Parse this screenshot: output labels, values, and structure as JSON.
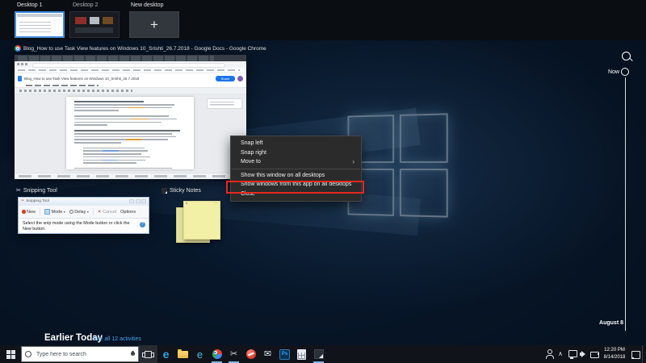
{
  "desktops_bar": {
    "desktops": [
      {
        "label": "Desktop 1",
        "selected": true
      },
      {
        "label": "Desktop 2",
        "selected": false
      }
    ],
    "new_desktop_label": "New desktop"
  },
  "thumbnails": {
    "chrome": {
      "title": "Blog_How to use Task View features on Windows 10_Srishti_26.7.2018 - Google Docs - Google Chrome",
      "doc_title": "Blog_How to use Task View features on Windows 10_Srishti_26.7.2018",
      "share_label": "Share"
    },
    "snipping_tool": {
      "label": "Snipping Tool",
      "window_title": "Snipping Tool",
      "toolbar": {
        "new_label": "New",
        "mode_label": "Mode",
        "delay_label": "Delay",
        "cancel_label": "Cancel",
        "options_label": "Options"
      },
      "message": "Select the snip mode using the Mode button or click the New button."
    },
    "sticky_notes": {
      "label": "Sticky Notes"
    }
  },
  "context_menu": {
    "items": [
      {
        "label": "Snap left"
      },
      {
        "label": "Snap right"
      },
      {
        "label": "Move to",
        "has_submenu": true
      },
      {
        "label": "Show this window on all desktops"
      },
      {
        "label": "Show windows from this app on all desktops",
        "highlighted": true
      },
      {
        "label": "Close"
      }
    ],
    "highlight_color": "#e8281e"
  },
  "timeline": {
    "now_label": "Now",
    "date_marker": "August 8"
  },
  "activities": {
    "heading": "Earlier Today",
    "see_all_label": "See all 12 activities"
  },
  "taskbar": {
    "search_placeholder": "Type here to search",
    "app_icons": [
      "task-view",
      "edge",
      "file-explorer",
      "internet-explorer",
      "chrome",
      "snipping-tool",
      "red-browser",
      "mail",
      "photoshop",
      "calculator",
      "sticky-notes"
    ],
    "tray_icons": [
      "people",
      "chevron-up",
      "display",
      "volume",
      "battery",
      "action-center"
    ],
    "clock": {
      "time": "12:20 PM",
      "date": "8/14/2018"
    }
  },
  "glyphs": {
    "plus": "+",
    "submenu_arrow": "›",
    "dropdown_arrow": "▾",
    "cancel_x": "✕",
    "help": "?",
    "scissors": "✂",
    "envelope": "✉",
    "edge_e": "e",
    "ie_e": "e",
    "photoshop_ps": "Ps",
    "chevron_up": "∧",
    "note_dots": "⋯"
  },
  "colors": {
    "accent_blue": "#0078d7",
    "selection_border": "#3e8ddb",
    "highlight_red": "#e8281e",
    "link_blue": "#4aa0e8",
    "share_button_blue": "#1a73e8",
    "sticky_note_yellow": "#f2efa6"
  }
}
